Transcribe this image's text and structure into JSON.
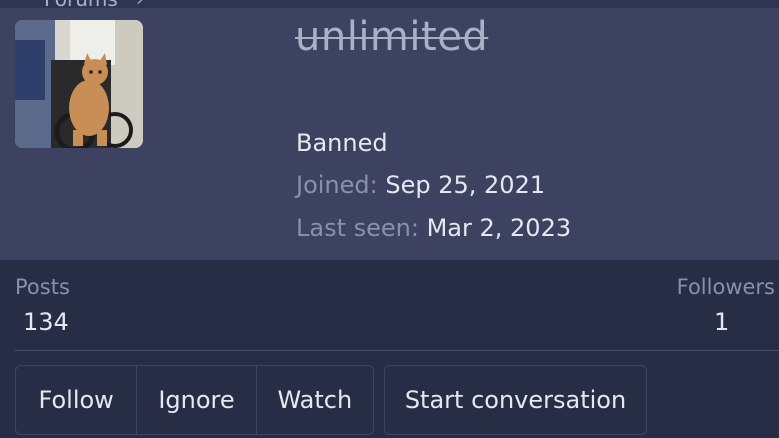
{
  "breadcrumb": {
    "label": "Forums",
    "chevron": "›"
  },
  "profile": {
    "avatar_icon": "cat-in-wheelchair-avatar",
    "username": "unlimited",
    "status": "Banned",
    "joined_label": "Joined:",
    "joined_value": "Sep 25, 2021",
    "last_seen_label": "Last seen:",
    "last_seen_value": "Mar 2, 2023"
  },
  "stats": {
    "posts_label": "Posts",
    "posts_value": "134",
    "followers_label": "Followers",
    "followers_value": "1"
  },
  "actions": {
    "follow": "Follow",
    "ignore": "Ignore",
    "watch": "Watch",
    "start_conversation": "Start conversation"
  },
  "colors": {
    "panel": "#3c4260",
    "background": "#272d45",
    "text": "#e6e8f0",
    "muted": "#8a90a8"
  }
}
